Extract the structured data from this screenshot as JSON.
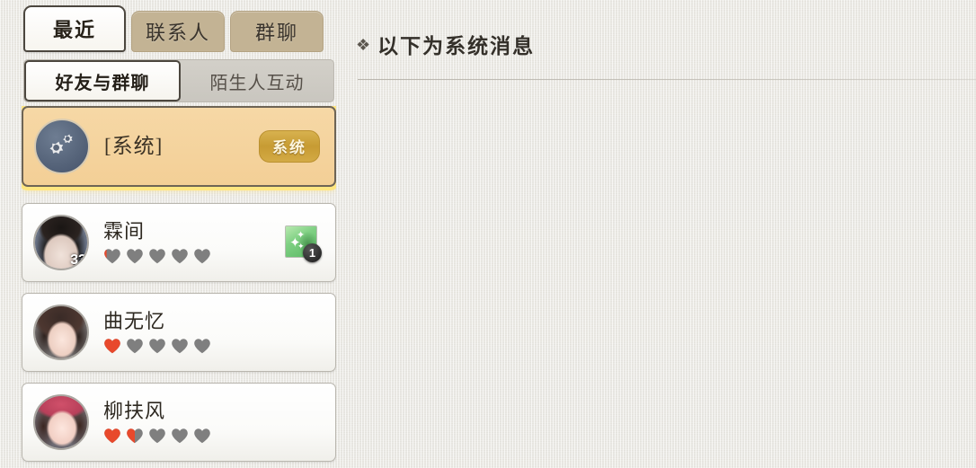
{
  "tabs": {
    "items": [
      {
        "label": "最近",
        "active": true
      },
      {
        "label": "联系人",
        "active": false
      },
      {
        "label": "群聊",
        "active": false
      }
    ]
  },
  "subtabs": {
    "items": [
      {
        "label": "好友与群聊",
        "active": true
      },
      {
        "label": "陌生人互动",
        "active": false
      }
    ]
  },
  "conversations": [
    {
      "name": "[系统]",
      "type": "system",
      "avatar_icon": "gears-icon",
      "badge_label": "系统",
      "selected": true
    },
    {
      "name": "霖间",
      "type": "friend",
      "level": "33",
      "hearts": {
        "total": 5,
        "filled": 0.18
      },
      "gift": {
        "icon": "green-gift-icon",
        "count": "1"
      }
    },
    {
      "name": "曲无忆",
      "type": "friend",
      "hearts": {
        "total": 5,
        "filled": 1
      }
    },
    {
      "name": "柳扶风",
      "type": "friend",
      "hearts": {
        "total": 5,
        "filled": 1.5
      }
    }
  ],
  "message_panel": {
    "ornament": "❖",
    "header": "以下为系统消息"
  },
  "colors": {
    "page_bg": "#eceae4",
    "tab_inactive": "#c3b394",
    "system_row_bg": "#f3cf96",
    "system_glow": "#ffe680",
    "badge_gold": "#c79b33",
    "heart_filled": "#e8492c",
    "heart_empty": "#7f7f7f",
    "gift_green": "#7fd083",
    "text_dark": "#2d2820"
  }
}
